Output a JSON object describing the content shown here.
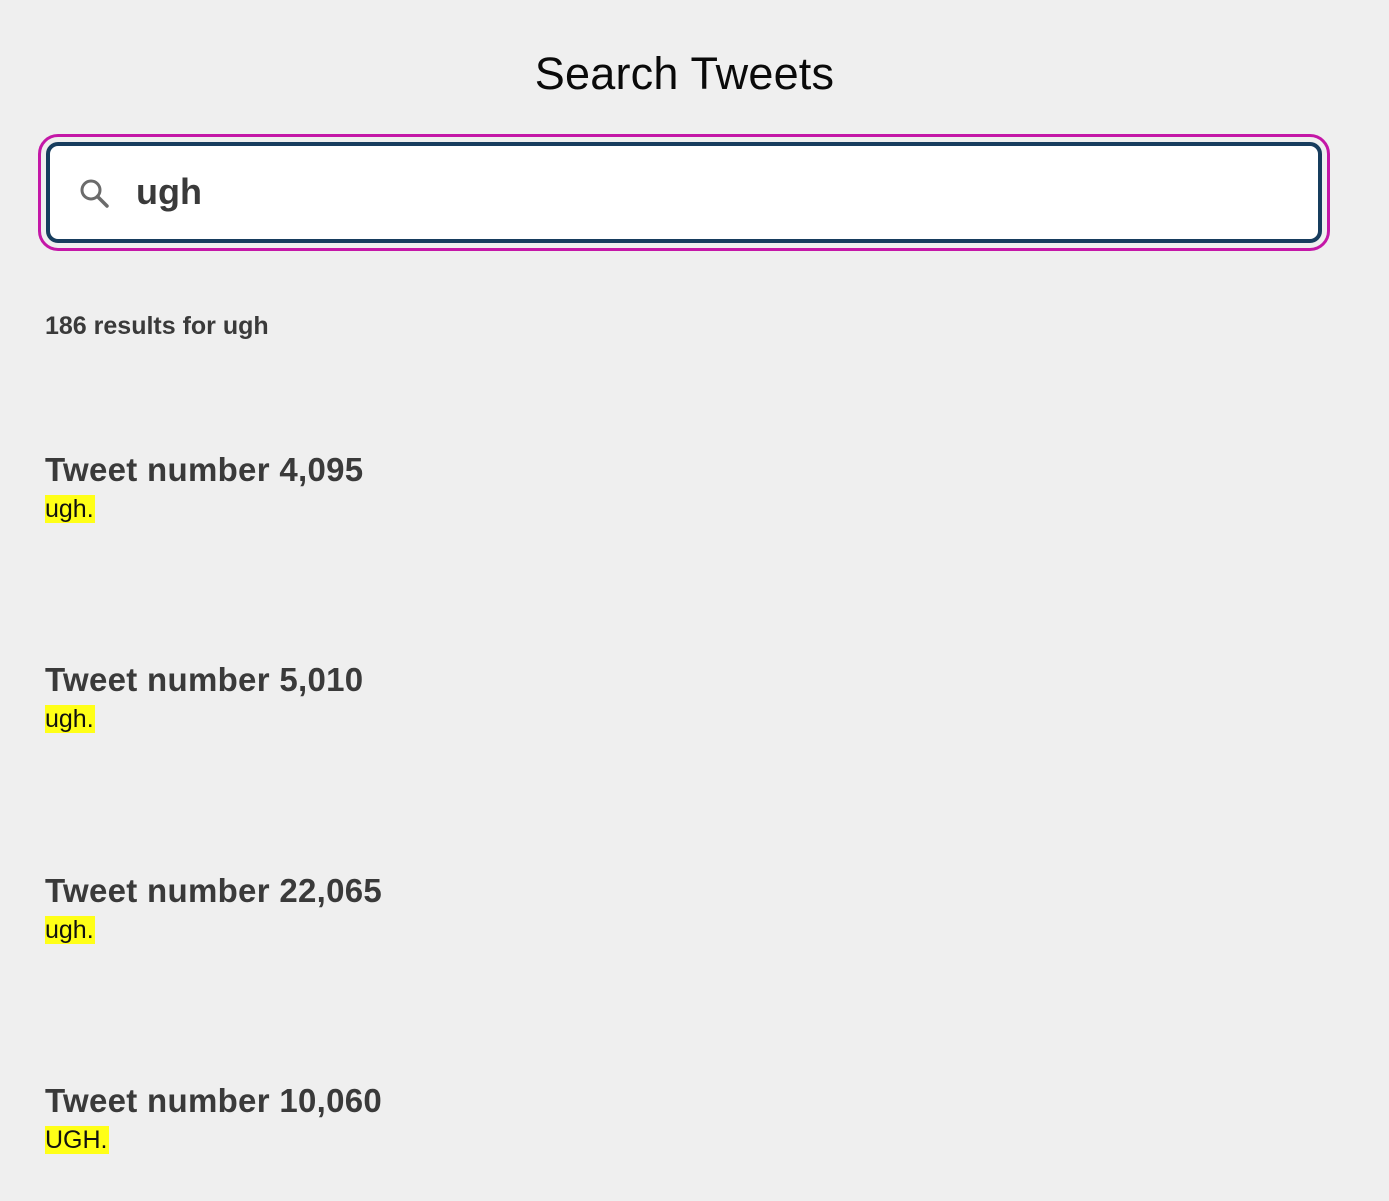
{
  "page": {
    "title": "Search Tweets"
  },
  "search": {
    "value": "ugh",
    "icon": "search-icon"
  },
  "results_summary": "186 results for ugh",
  "results": [
    {
      "title": "Tweet number 4,095",
      "text": "ugh."
    },
    {
      "title": "Tweet number 5,010",
      "text": "ugh."
    },
    {
      "title": "Tweet number 22,065",
      "text": "ugh."
    },
    {
      "title": "Tweet number 10,060",
      "text": "UGH."
    }
  ],
  "colors": {
    "background": "#efefef",
    "focus_ring": "#c417a7",
    "input_border": "#173d5e",
    "highlight": "#ffff17"
  }
}
